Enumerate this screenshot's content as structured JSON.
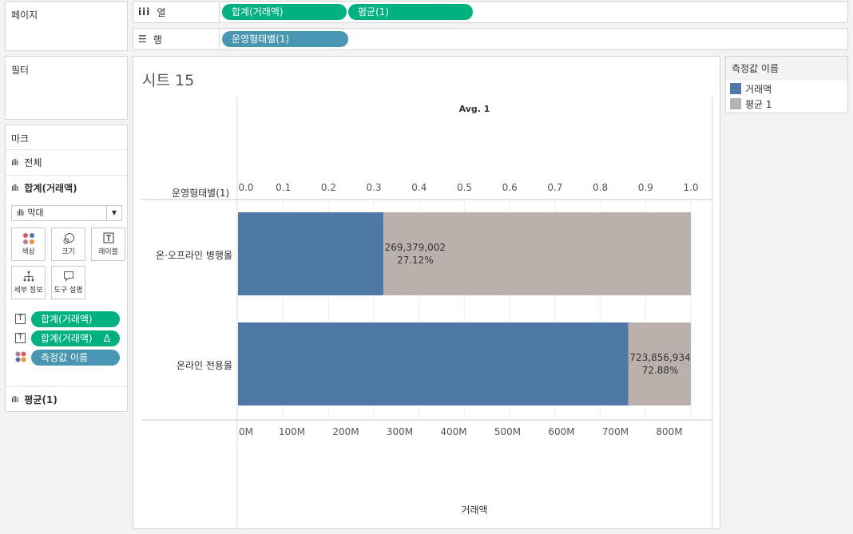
{
  "pages_panel": {
    "title": "페이지"
  },
  "filters_panel": {
    "title": "필터"
  },
  "columns_shelf": {
    "icon": "columns-icon",
    "label": "열",
    "pills": [
      "합계(거래액)",
      "평균(1)"
    ]
  },
  "rows_shelf": {
    "icon": "rows-icon",
    "label": "행",
    "pills": [
      "운영형태별(1)"
    ]
  },
  "marks_card": {
    "title": "마크",
    "all_label": "전체",
    "active_label": "합계(거래액)",
    "mark_type": "막대",
    "buttons": {
      "color": "색상",
      "size": "크기",
      "label": "레이블",
      "detail": "세부 정보",
      "tooltip": "도구 설명"
    },
    "pills": [
      "합계(거래액)",
      "합계(거래액)",
      "측정값 이름"
    ],
    "delta_symbol": "Δ",
    "avg_label": "평균(1)"
  },
  "sheet": {
    "title": "시트 15",
    "top_axis_title": "Avg. 1",
    "row_header_title": "운영형태별(1)",
    "top_ticks": [
      "0.0",
      "0.1",
      "0.2",
      "0.3",
      "0.4",
      "0.5",
      "0.6",
      "0.7",
      "0.8",
      "0.9",
      "1.0"
    ],
    "bottom_ticks": [
      "0M",
      "100M",
      "200M",
      "300M",
      "400M",
      "500M",
      "600M",
      "700M",
      "800M"
    ],
    "bottom_axis_title": "거래액",
    "rows": [
      {
        "label": "온·오프라인 병행몰",
        "value_label": "269,379,002",
        "pct_label": "27.12%"
      },
      {
        "label": "온라인 전용몰",
        "value_label": "723,856,934",
        "pct_label": "72.88%"
      }
    ]
  },
  "legend": {
    "title": "측정값 이름",
    "items": [
      {
        "label": "거래액",
        "color": "#4e79a7"
      },
      {
        "label": "평균 1",
        "color": "#bab0ac"
      }
    ]
  },
  "chart_data": {
    "type": "bar",
    "categories": [
      "온·오프라인 병행몰",
      "온라인 전용몰"
    ],
    "series": [
      {
        "name": "거래액",
        "values": [
          269379002,
          723856934
        ]
      },
      {
        "name": "평균 1",
        "values": [
          1.0,
          1.0
        ]
      }
    ],
    "percent_of_total": [
      27.12,
      72.88
    ],
    "xlabel": "거래액",
    "x2label": "Avg. 1",
    "ylabel": "운영형태별(1)",
    "xlim": [
      0,
      840000000
    ],
    "x2lim": [
      0,
      1.0
    ],
    "orientation": "horizontal",
    "grid": true,
    "legend_position": "right",
    "colors": {
      "거래액": "#4e79a7",
      "평균 1": "#bab0ac"
    }
  }
}
